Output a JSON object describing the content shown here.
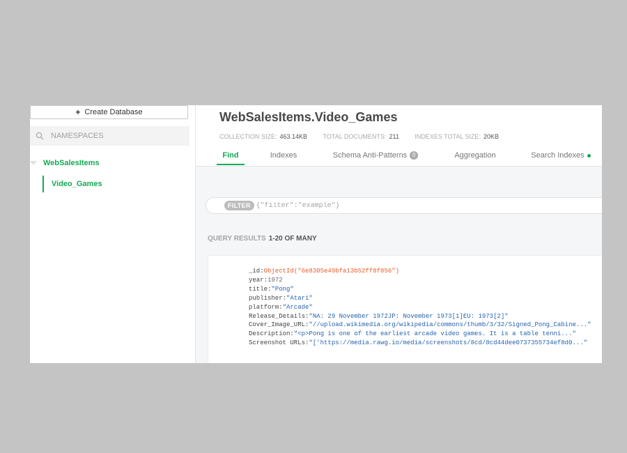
{
  "sidebar": {
    "create_label": "Create Database",
    "search_placeholder": "NAMESPACES",
    "database": "WebSalesItems",
    "collection": "Video_Games"
  },
  "header": {
    "title": "WebSalesItems.Video_Games",
    "stats": [
      {
        "label": "COLLECTION SIZE:",
        "value": "463.14KB"
      },
      {
        "label": "TOTAL DOCUMENTS:",
        "value": "211"
      },
      {
        "label": "INDEXES TOTAL SIZE:",
        "value": "20KB"
      }
    ]
  },
  "tabs": [
    {
      "label": "Find"
    },
    {
      "label": "Indexes"
    },
    {
      "label": "Schema Anti-Patterns",
      "badge": "0"
    },
    {
      "label": "Aggregation"
    },
    {
      "label": "Search Indexes"
    }
  ],
  "filter": {
    "chip": "FILTER",
    "placeholder": "{\"filter\":\"example\"}"
  },
  "results": {
    "label": "QUERY RESULTS",
    "range": "1-20 OF MANY"
  },
  "document": {
    "fields": [
      {
        "key": "_id:",
        "value": "ObjectId(\"6e8305e49bfa13b52ff8f856\")",
        "type": "o"
      },
      {
        "key": "year:",
        "value": "1972",
        "type": "n"
      },
      {
        "key": "title:",
        "value": "\"Pong\"",
        "type": "s"
      },
      {
        "key": "publisher:",
        "value": "\"Atari\"",
        "type": "s"
      },
      {
        "key": "platform:",
        "value": "\"Arcade\"",
        "type": "s"
      },
      {
        "key": "Release_Details:",
        "value": "\"NA: 29 November 1972JP: November 1973[1]EU: 1973[2]\"",
        "type": "s"
      },
      {
        "key": "Cover_Image_URL:",
        "value": "\"//upload.wikimedia.org/wikipedia/commons/thumb/3/32/Signed_Pong_Cabine...\"",
        "type": "s"
      },
      {
        "key": "Description:",
        "value": "\"<p>Pong is one of the earliest arcade video games. It is a table tenni...\"",
        "type": "s"
      },
      {
        "key": "Screenshot URLs:",
        "value": "\"['https://media.rawg.io/media/screenshots/8cd/8cd44dee0737355734ef8d0...\"",
        "type": "s"
      }
    ]
  }
}
